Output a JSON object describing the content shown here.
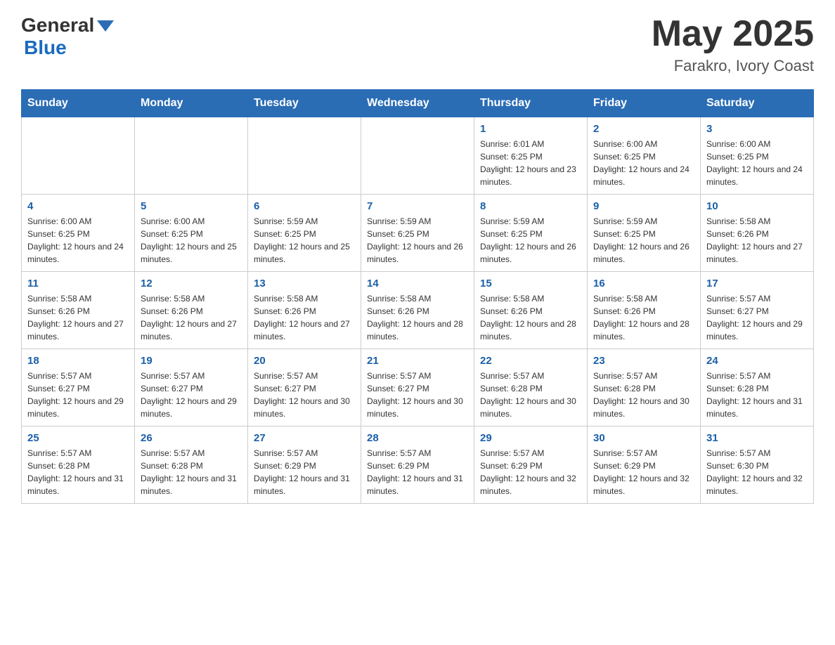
{
  "logo": {
    "text_general": "General",
    "text_blue": "Blue"
  },
  "header": {
    "month_year": "May 2025",
    "location": "Farakro, Ivory Coast"
  },
  "days_of_week": [
    "Sunday",
    "Monday",
    "Tuesday",
    "Wednesday",
    "Thursday",
    "Friday",
    "Saturday"
  ],
  "weeks": [
    [
      {
        "day": "",
        "info": ""
      },
      {
        "day": "",
        "info": ""
      },
      {
        "day": "",
        "info": ""
      },
      {
        "day": "",
        "info": ""
      },
      {
        "day": "1",
        "info": "Sunrise: 6:01 AM\nSunset: 6:25 PM\nDaylight: 12 hours and 23 minutes."
      },
      {
        "day": "2",
        "info": "Sunrise: 6:00 AM\nSunset: 6:25 PM\nDaylight: 12 hours and 24 minutes."
      },
      {
        "day": "3",
        "info": "Sunrise: 6:00 AM\nSunset: 6:25 PM\nDaylight: 12 hours and 24 minutes."
      }
    ],
    [
      {
        "day": "4",
        "info": "Sunrise: 6:00 AM\nSunset: 6:25 PM\nDaylight: 12 hours and 24 minutes."
      },
      {
        "day": "5",
        "info": "Sunrise: 6:00 AM\nSunset: 6:25 PM\nDaylight: 12 hours and 25 minutes."
      },
      {
        "day": "6",
        "info": "Sunrise: 5:59 AM\nSunset: 6:25 PM\nDaylight: 12 hours and 25 minutes."
      },
      {
        "day": "7",
        "info": "Sunrise: 5:59 AM\nSunset: 6:25 PM\nDaylight: 12 hours and 26 minutes."
      },
      {
        "day": "8",
        "info": "Sunrise: 5:59 AM\nSunset: 6:25 PM\nDaylight: 12 hours and 26 minutes."
      },
      {
        "day": "9",
        "info": "Sunrise: 5:59 AM\nSunset: 6:25 PM\nDaylight: 12 hours and 26 minutes."
      },
      {
        "day": "10",
        "info": "Sunrise: 5:58 AM\nSunset: 6:26 PM\nDaylight: 12 hours and 27 minutes."
      }
    ],
    [
      {
        "day": "11",
        "info": "Sunrise: 5:58 AM\nSunset: 6:26 PM\nDaylight: 12 hours and 27 minutes."
      },
      {
        "day": "12",
        "info": "Sunrise: 5:58 AM\nSunset: 6:26 PM\nDaylight: 12 hours and 27 minutes."
      },
      {
        "day": "13",
        "info": "Sunrise: 5:58 AM\nSunset: 6:26 PM\nDaylight: 12 hours and 27 minutes."
      },
      {
        "day": "14",
        "info": "Sunrise: 5:58 AM\nSunset: 6:26 PM\nDaylight: 12 hours and 28 minutes."
      },
      {
        "day": "15",
        "info": "Sunrise: 5:58 AM\nSunset: 6:26 PM\nDaylight: 12 hours and 28 minutes."
      },
      {
        "day": "16",
        "info": "Sunrise: 5:58 AM\nSunset: 6:26 PM\nDaylight: 12 hours and 28 minutes."
      },
      {
        "day": "17",
        "info": "Sunrise: 5:57 AM\nSunset: 6:27 PM\nDaylight: 12 hours and 29 minutes."
      }
    ],
    [
      {
        "day": "18",
        "info": "Sunrise: 5:57 AM\nSunset: 6:27 PM\nDaylight: 12 hours and 29 minutes."
      },
      {
        "day": "19",
        "info": "Sunrise: 5:57 AM\nSunset: 6:27 PM\nDaylight: 12 hours and 29 minutes."
      },
      {
        "day": "20",
        "info": "Sunrise: 5:57 AM\nSunset: 6:27 PM\nDaylight: 12 hours and 30 minutes."
      },
      {
        "day": "21",
        "info": "Sunrise: 5:57 AM\nSunset: 6:27 PM\nDaylight: 12 hours and 30 minutes."
      },
      {
        "day": "22",
        "info": "Sunrise: 5:57 AM\nSunset: 6:28 PM\nDaylight: 12 hours and 30 minutes."
      },
      {
        "day": "23",
        "info": "Sunrise: 5:57 AM\nSunset: 6:28 PM\nDaylight: 12 hours and 30 minutes."
      },
      {
        "day": "24",
        "info": "Sunrise: 5:57 AM\nSunset: 6:28 PM\nDaylight: 12 hours and 31 minutes."
      }
    ],
    [
      {
        "day": "25",
        "info": "Sunrise: 5:57 AM\nSunset: 6:28 PM\nDaylight: 12 hours and 31 minutes."
      },
      {
        "day": "26",
        "info": "Sunrise: 5:57 AM\nSunset: 6:28 PM\nDaylight: 12 hours and 31 minutes."
      },
      {
        "day": "27",
        "info": "Sunrise: 5:57 AM\nSunset: 6:29 PM\nDaylight: 12 hours and 31 minutes."
      },
      {
        "day": "28",
        "info": "Sunrise: 5:57 AM\nSunset: 6:29 PM\nDaylight: 12 hours and 31 minutes."
      },
      {
        "day": "29",
        "info": "Sunrise: 5:57 AM\nSunset: 6:29 PM\nDaylight: 12 hours and 32 minutes."
      },
      {
        "day": "30",
        "info": "Sunrise: 5:57 AM\nSunset: 6:29 PM\nDaylight: 12 hours and 32 minutes."
      },
      {
        "day": "31",
        "info": "Sunrise: 5:57 AM\nSunset: 6:30 PM\nDaylight: 12 hours and 32 minutes."
      }
    ]
  ]
}
